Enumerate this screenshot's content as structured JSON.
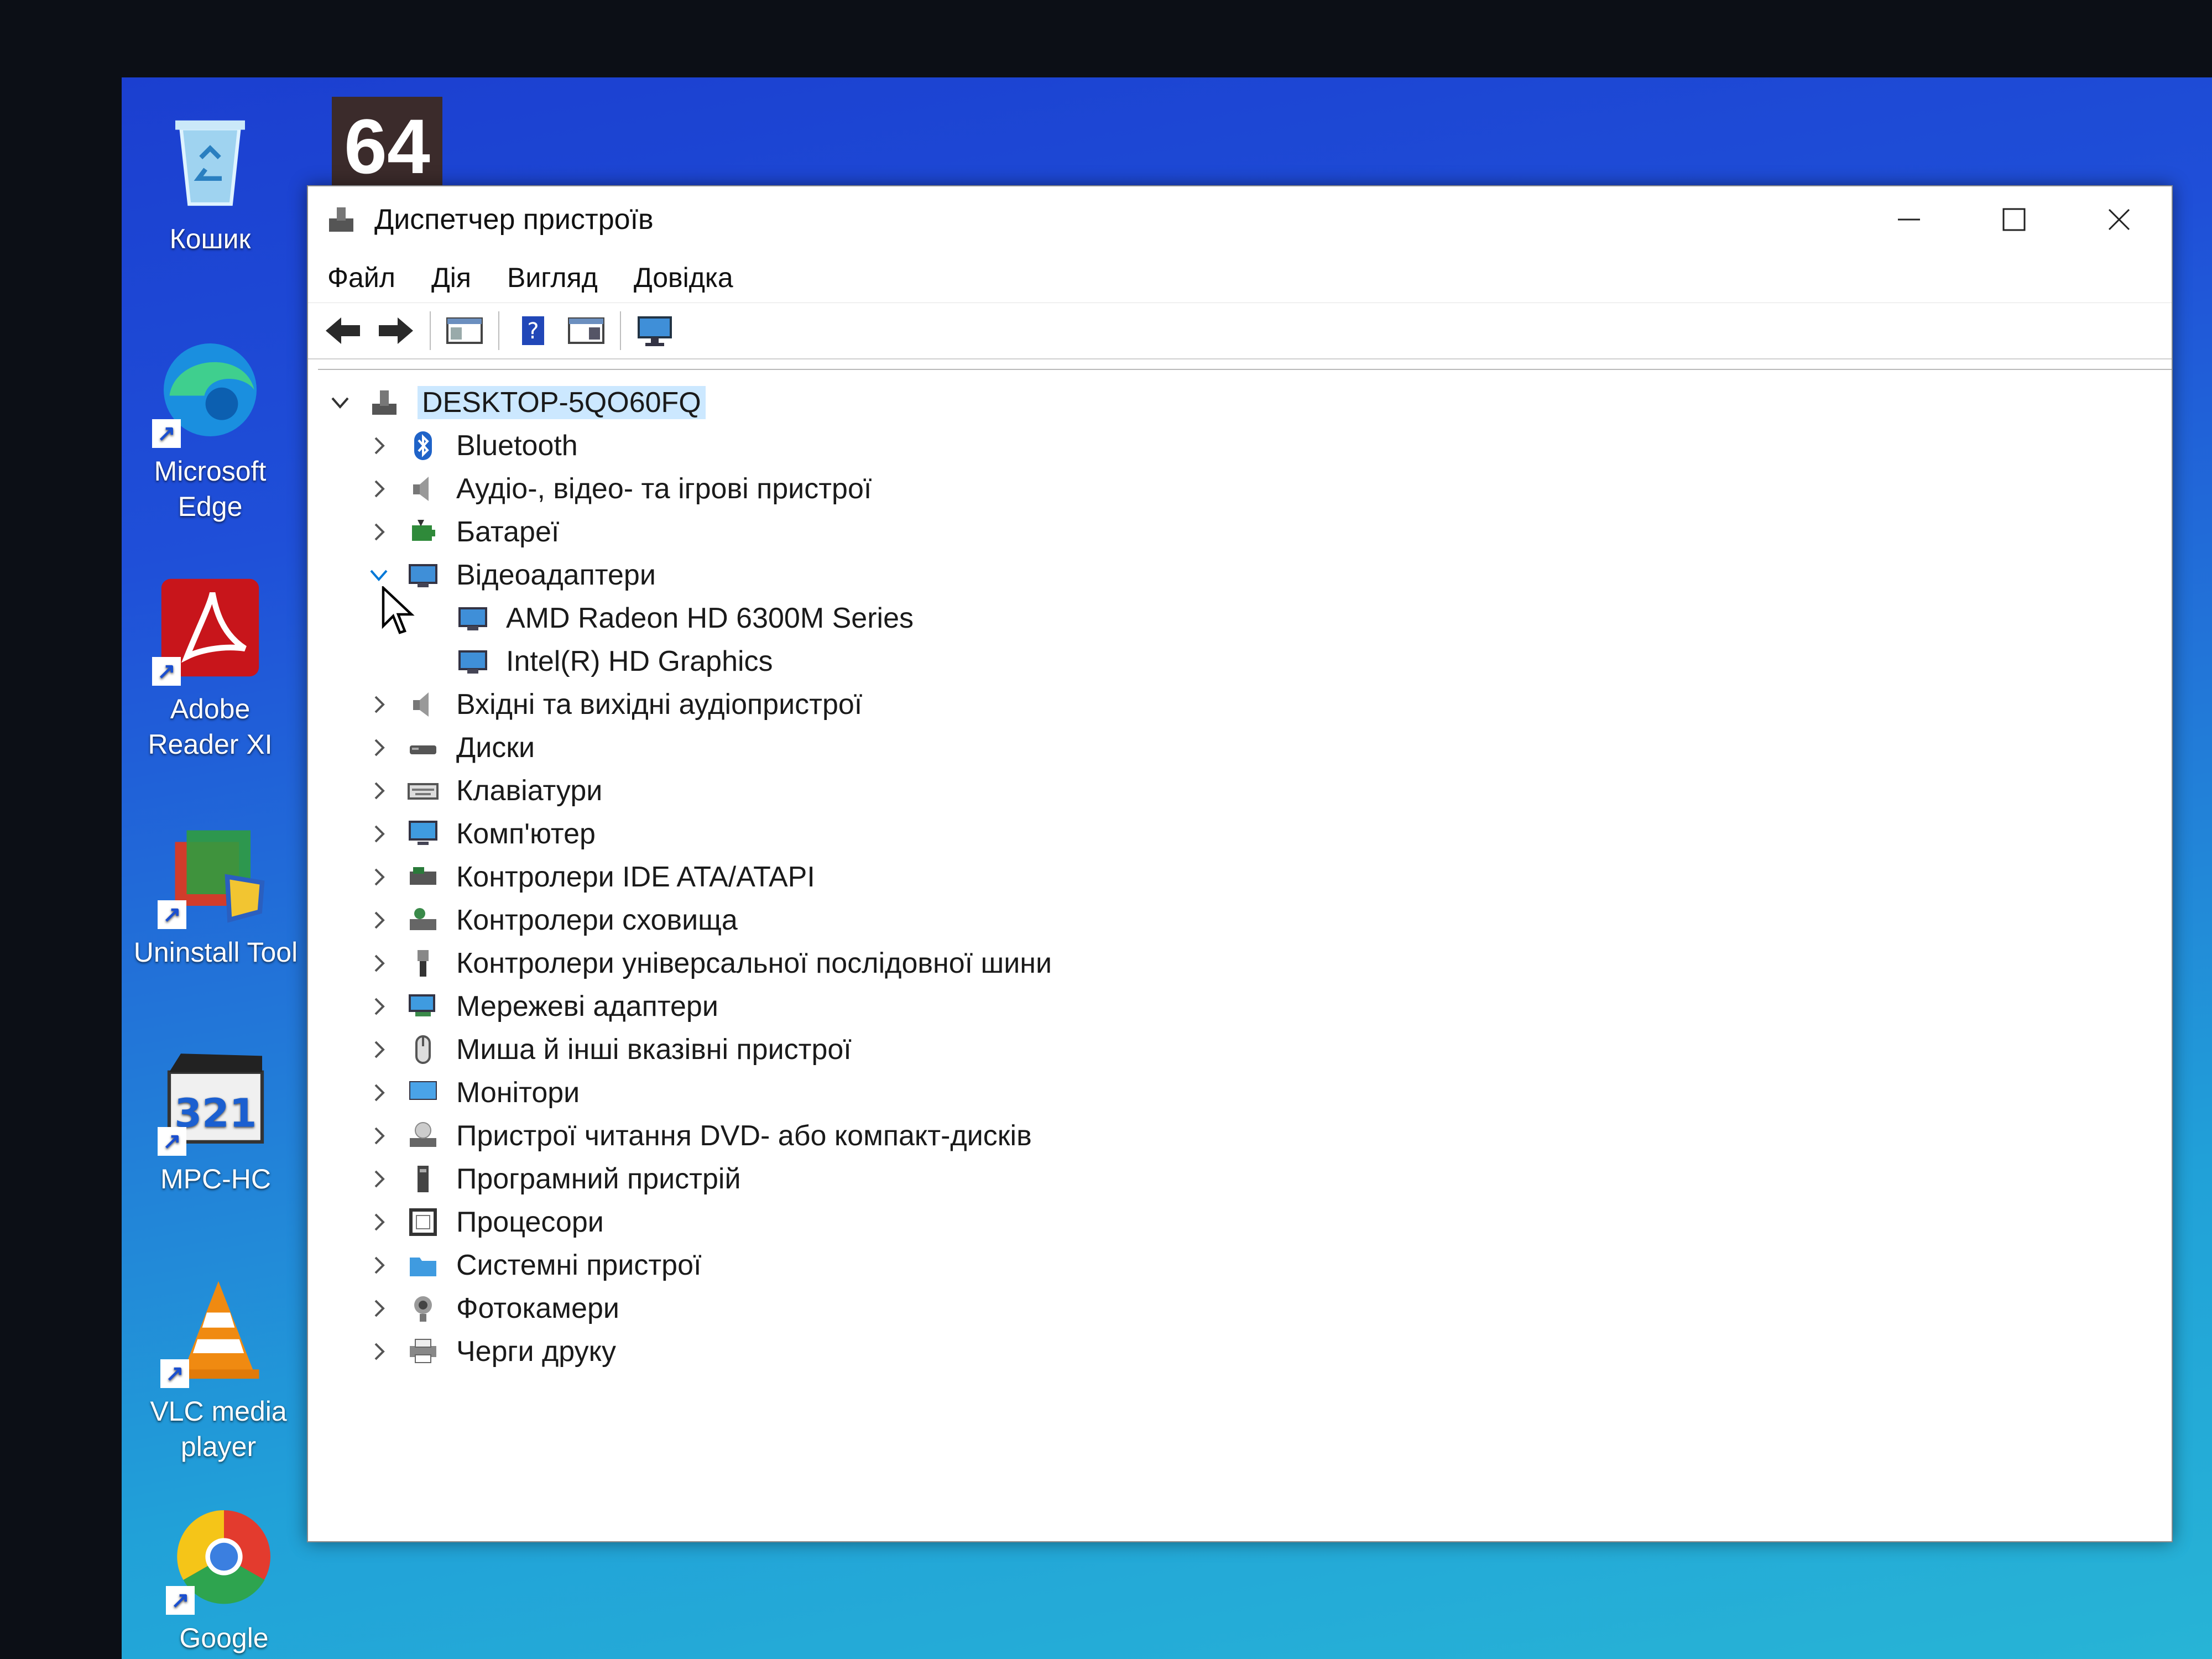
{
  "desktop": {
    "tile_text": "64",
    "icons": [
      {
        "name": "recycle-bin",
        "label": "Кошик"
      },
      {
        "name": "microsoft-edge",
        "label": "Microsoft Edge"
      },
      {
        "name": "adobe-reader",
        "label": "Adobe Reader XI"
      },
      {
        "name": "uninstall-tool",
        "label": "Uninstall Tool"
      },
      {
        "name": "mpc-hc",
        "label": "MPC-HC"
      },
      {
        "name": "vlc",
        "label": "VLC media player"
      },
      {
        "name": "google-chrome",
        "label": "Google"
      }
    ]
  },
  "window": {
    "title": "Диспетчер пристроїв",
    "menu": [
      "Файл",
      "Дія",
      "Вигляд",
      "Довідка"
    ],
    "toolbar_icons": [
      "back-arrow-icon",
      "forward-arrow-icon",
      "properties-panel-icon",
      "help-icon",
      "update-driver-icon",
      "monitor-scan-icon"
    ]
  },
  "tree": {
    "root": "DESKTOP-5QO60FQ",
    "categories": [
      {
        "label": "Bluetooth",
        "icon": "bluetooth-icon",
        "expanded": false
      },
      {
        "label": "Аудіо-, відео- та ігрові пристрої",
        "icon": "speaker-icon",
        "expanded": false
      },
      {
        "label": "Батареї",
        "icon": "battery-icon",
        "expanded": false
      },
      {
        "label": "Відеоадаптери",
        "icon": "display-adapter-icon",
        "expanded": true,
        "children": [
          "AMD Radeon HD 6300M Series",
          "Intel(R) HD Graphics"
        ]
      },
      {
        "label": "Вхідні та вихідні аудіопристрої",
        "icon": "speaker-icon",
        "expanded": false
      },
      {
        "label": "Диски",
        "icon": "disk-icon",
        "expanded": false
      },
      {
        "label": "Клавіатури",
        "icon": "keyboard-icon",
        "expanded": false
      },
      {
        "label": "Комп'ютер",
        "icon": "computer-icon",
        "expanded": false
      },
      {
        "label": "Контролери IDE ATA/ATAPI",
        "icon": "ide-controller-icon",
        "expanded": false
      },
      {
        "label": "Контролери сховища",
        "icon": "storage-controller-icon",
        "expanded": false
      },
      {
        "label": "Контролери універсальної послідовної шини",
        "icon": "usb-icon",
        "expanded": false
      },
      {
        "label": "Мережеві адаптери",
        "icon": "network-adapter-icon",
        "expanded": false
      },
      {
        "label": "Миша й інші вказівні пристрої",
        "icon": "mouse-icon",
        "expanded": false
      },
      {
        "label": "Монітори",
        "icon": "monitor-icon",
        "expanded": false
      },
      {
        "label": "Пристрої читання DVD- або компакт-дисків",
        "icon": "dvd-icon",
        "expanded": false
      },
      {
        "label": "Програмний пристрій",
        "icon": "software-device-icon",
        "expanded": false
      },
      {
        "label": "Процесори",
        "icon": "processor-icon",
        "expanded": false
      },
      {
        "label": "Системні пристрої",
        "icon": "system-devices-icon",
        "expanded": false
      },
      {
        "label": "Фотокамери",
        "icon": "camera-icon",
        "expanded": false
      },
      {
        "label": "Черги друку",
        "icon": "printer-icon",
        "expanded": false
      }
    ]
  },
  "colors": {
    "accent": "#0078d7",
    "selection": "#cce8ff",
    "desktop": "#1f4fd8"
  }
}
